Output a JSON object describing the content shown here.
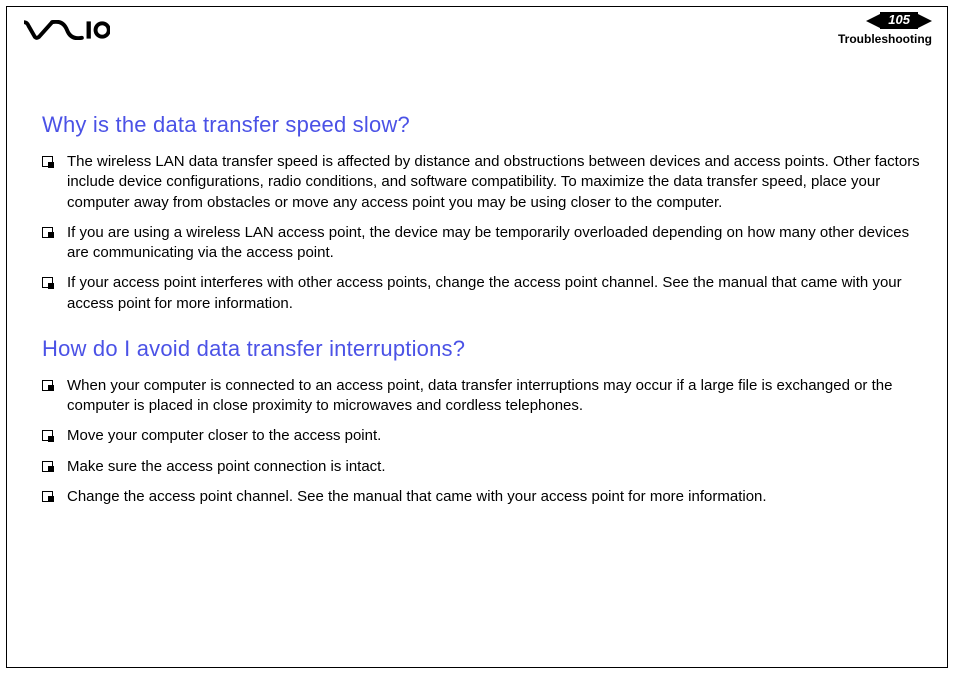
{
  "header": {
    "page_number": "105",
    "section_label": "Troubleshooting"
  },
  "sections": [
    {
      "heading": "Why is the data transfer speed slow?",
      "items": [
        "The wireless LAN data transfer speed is affected by distance and obstructions between devices and access points. Other factors include device configurations, radio conditions, and software compatibility. To maximize the data transfer speed, place your computer away from obstacles or move any access point you may be using closer to the computer.",
        "If you are using a wireless LAN access point, the device may be temporarily overloaded depending on how many other devices are communicating via the access point.",
        "If your access point interferes with other access points, change the access point channel. See the manual that came with your access point for more information."
      ]
    },
    {
      "heading": "How do I avoid data transfer interruptions?",
      "items": [
        "When your computer is connected to an access point, data transfer interruptions may occur if a large file is exchanged or the computer is placed in close proximity to microwaves and cordless telephones.",
        "Move your computer closer to the access point.",
        "Make sure the access point connection is intact.",
        "Change the access point channel. See the manual that came with your access point for more information."
      ]
    }
  ]
}
